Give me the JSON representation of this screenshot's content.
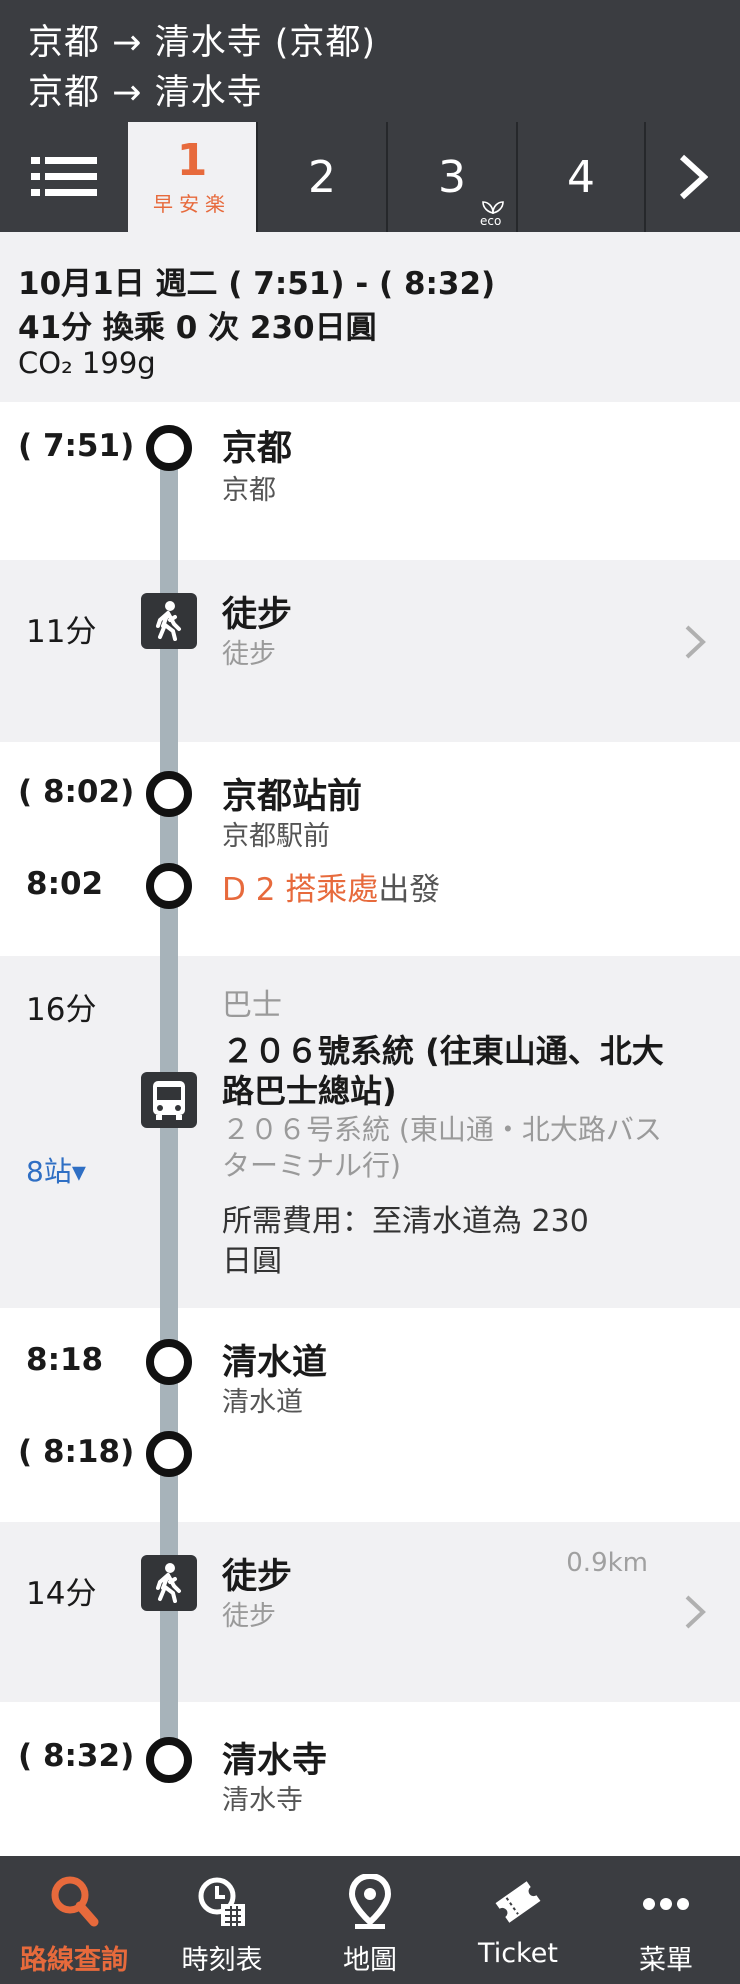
{
  "header": {
    "line1": "京都 → 清水寺 (京都)",
    "line2": "京都 → 清水寺"
  },
  "tabs": {
    "menu_icon": "list-icon",
    "items": [
      {
        "num": "1",
        "sub": "早安楽"
      },
      {
        "num": "2"
      },
      {
        "num": "3",
        "badge": "eco"
      },
      {
        "num": "4"
      }
    ],
    "next": "›"
  },
  "summary": {
    "line1": "10月1日 週二 ( 7:51) - ( 8:32)",
    "line2": "41分 換乘 0 次 230日圓",
    "co2": "CO₂ 199g"
  },
  "route": {
    "kyoto": {
      "time": "( 7:51)",
      "name": "京都",
      "sub": "京都"
    },
    "walk1": {
      "duration": "11分",
      "name": "徒步",
      "sub": "徒步"
    },
    "stop1": {
      "time": "( 8:02)",
      "name": "京都站前",
      "sub": "京都駅前"
    },
    "board": {
      "time": "8:02",
      "highlight": "D 2 搭乘處",
      "rest": "出發"
    },
    "bus": {
      "duration": "16分",
      "stops": "8站▾",
      "type": "巴士",
      "line_a": "２０６號系統 (往東山通、北大",
      "line_b": "路巴士總站)",
      "sub_a": "２０６号系統 (東山通・北大路バス",
      "sub_b": "ターミナル行)",
      "fare_a": "所需費用：至清水道為 230",
      "fare_b": "日圓"
    },
    "stop2": {
      "time": "8:18",
      "name": "清水道",
      "sub": "清水道"
    },
    "stop2b": {
      "time": "( 8:18)"
    },
    "walk2": {
      "duration": "14分",
      "name": "徒步",
      "sub": "徒步",
      "dist": "0.9km"
    },
    "dest": {
      "time": "( 8:32)",
      "name": "清水寺",
      "sub": "清水寺"
    }
  },
  "nav": {
    "items": [
      {
        "label": "路線查詢",
        "icon": "search-icon"
      },
      {
        "label": "時刻表",
        "icon": "timetable-icon"
      },
      {
        "label": "地圖",
        "icon": "map-pin-icon"
      },
      {
        "label": "Ticket",
        "icon": "ticket-icon"
      },
      {
        "label": "菜單",
        "icon": "more-icon"
      }
    ]
  },
  "colors": {
    "accent": "#e76a3c",
    "dark": "#3b3d41",
    "panel": "#f1f1f3",
    "line": "#a7b3ba",
    "link": "#2f6fc4"
  }
}
